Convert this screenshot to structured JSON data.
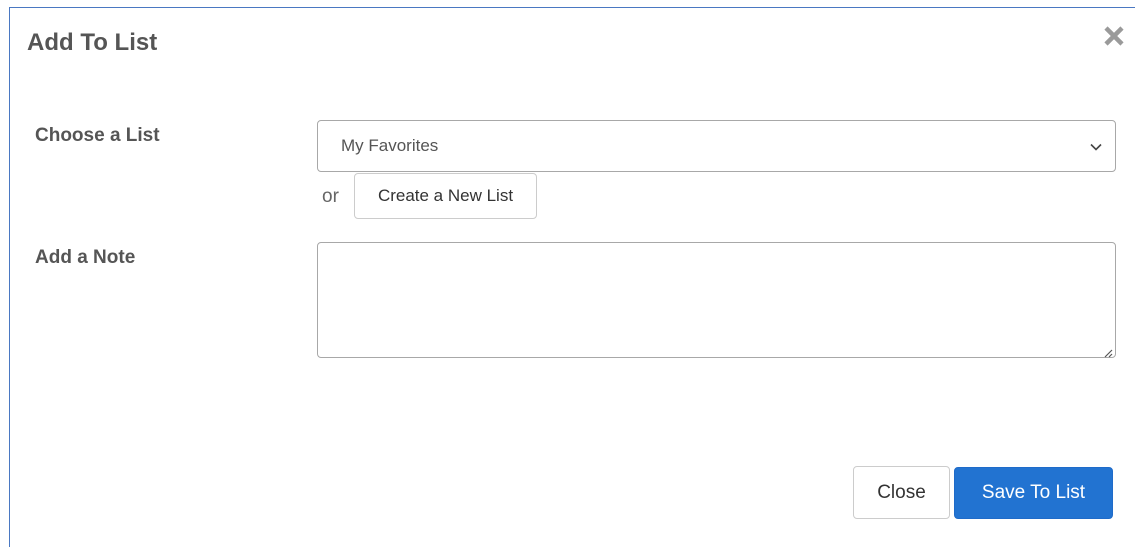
{
  "modal": {
    "title": "Add To List",
    "close_icon": "close-x-icon"
  },
  "form": {
    "list_label": "Choose a List",
    "selected_list": "My Favorites",
    "or_text": "or",
    "create_list_label": "Create a New List",
    "note_label": "Add a Note",
    "note_value": ""
  },
  "footer": {
    "close_label": "Close",
    "save_label": "Save To List"
  },
  "colors": {
    "primary": "#2273d1",
    "border_accent": "#4a78c2",
    "label_text": "#555555"
  }
}
